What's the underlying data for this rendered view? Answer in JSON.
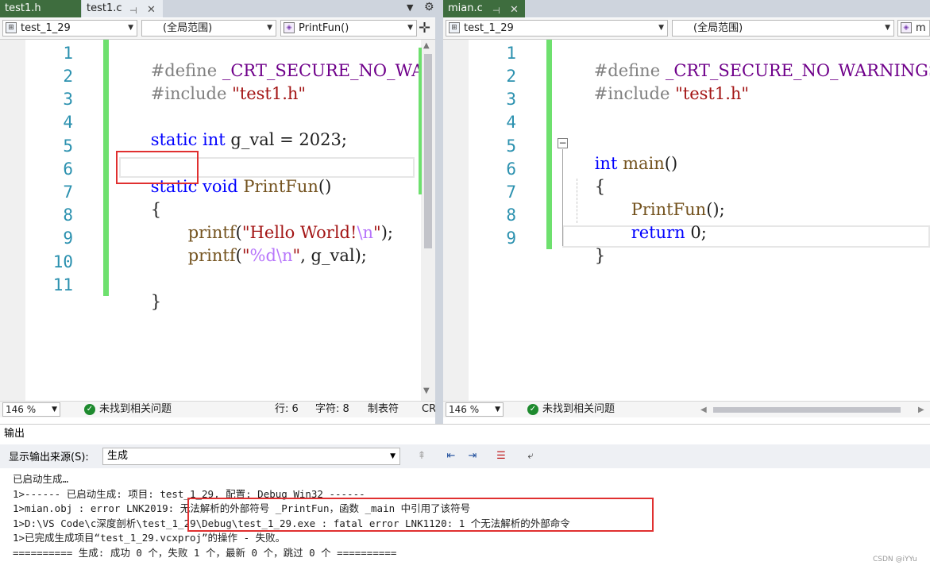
{
  "left_pane": {
    "tabs": [
      {
        "label": "test1.h",
        "active": false
      },
      {
        "label": "test1.c",
        "active": true
      }
    ],
    "nav": {
      "project": "test_1_29",
      "scope": "(全局范围)",
      "member": "PrintFun()"
    },
    "lines": [
      "1",
      "2",
      "3",
      "4",
      "5",
      "6",
      "7",
      "8",
      "9",
      "10",
      "11"
    ],
    "code": {
      "l1_directive": "#define",
      "l1_macro": "_CRT_SECURE_NO_WARNINGS",
      "l2_directive": "#include",
      "l2_file": "\"test1.h\"",
      "l4_static": "static",
      "l4_type": "int",
      "l4_rest": "g_val = 2023;",
      "l6_static": "static",
      "l6_void": "void",
      "l6_fn": "PrintFun",
      "l6_rest": "()",
      "l7": "{",
      "l8_fn": "printf",
      "l8_open": "(",
      "l8_str": "\"Hello World!",
      "l8_esc": "\\n",
      "l8_strend": "\"",
      "l8_close": ");",
      "l9_fn": "printf",
      "l9_open": "(",
      "l9_str1": "\"",
      "l9_fmt": "%d",
      "l9_esc": "\\n",
      "l9_str2": "\"",
      "l9_rest": ", g_val);",
      "l11": "}"
    },
    "status": {
      "zoom": "146 %",
      "issues": "未找到相关问题",
      "line": "行: 6",
      "col": "字符: 8",
      "tabs": "制表符",
      "eol": "CR"
    }
  },
  "right_pane": {
    "tabs": [
      {
        "label": "mian.c",
        "active": false
      }
    ],
    "nav": {
      "project": "test_1_29",
      "scope": "(全局范围)",
      "member": "m"
    },
    "lines": [
      "1",
      "2",
      "3",
      "4",
      "5",
      "6",
      "7",
      "8",
      "9"
    ],
    "code": {
      "l1_directive": "#define",
      "l1_macro": "_CRT_SECURE_NO_WARNINGS",
      "l2_directive": "#include",
      "l2_file": "\"test1.h\"",
      "l5_type": "int",
      "l5_fn": "main",
      "l5_rest": "()",
      "l6": "{",
      "l7_fn": "PrintFun",
      "l7_rest": "();",
      "l8_kw": "return",
      "l8_rest": "0;",
      "l9": "}"
    },
    "status": {
      "zoom": "146 %",
      "issues": "未找到相关问题"
    }
  },
  "output": {
    "title": "输出",
    "source_label": "显示输出来源(S):",
    "source_value": "生成",
    "lines": [
      "已启动生成…",
      "1>------ 已启动生成: 项目: test_1_29, 配置: Debug Win32 ------",
      "1>mian.obj : error LNK2019: 无法解析的外部符号 _PrintFun，函数 _main 中引用了该符号",
      "1>D:\\VS Code\\c深度剖析\\test_1_29\\Debug\\test_1_29.exe : fatal error LNK1120: 1 个无法解析的外部命令",
      "1>已完成生成项目“test_1_29.vcxproj”的操作 - 失败。",
      "========== 生成: 成功 0 个，失败 1 个，最新 0 个，跳过 0 个 =========="
    ]
  },
  "watermark": "CSDN @iYYu",
  "colors": {
    "accent_green": "#6ee06e",
    "error_box": "#e03030",
    "keyword": "#0000ff",
    "string": "#a31515",
    "line_number": "#2b91af"
  }
}
